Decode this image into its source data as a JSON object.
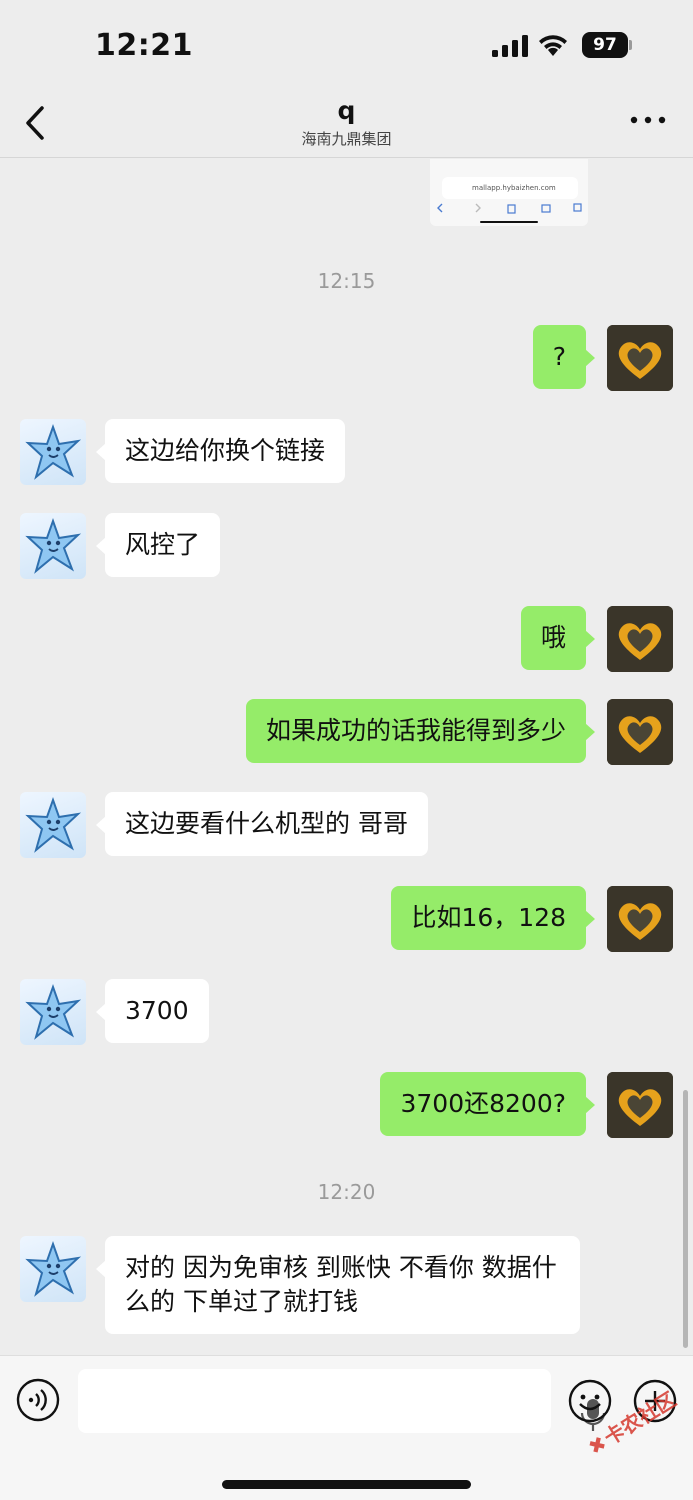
{
  "status_bar": {
    "time": "12:21",
    "battery": "97"
  },
  "nav": {
    "title": "q",
    "subtitle": "海南九鼎集团"
  },
  "screenshot_thumb": {
    "url": "mallapp.hybaizhen.com"
  },
  "timestamps": [
    "12:15",
    "12:20"
  ],
  "messages": [
    {
      "from": "self",
      "text": "?"
    },
    {
      "from": "other",
      "text": "这边给你换个链接"
    },
    {
      "from": "other",
      "text": "风控了"
    },
    {
      "from": "self",
      "text": "哦"
    },
    {
      "from": "self",
      "text": "如果成功的话我能得到多少"
    },
    {
      "from": "other",
      "text": "这边要看什么机型的 哥哥"
    },
    {
      "from": "self",
      "text": "比如16，128"
    },
    {
      "from": "other",
      "text": "3700"
    },
    {
      "from": "self",
      "text": "3700还8200?"
    },
    {
      "from": "other",
      "text": "对的 因为免审核 到账快 不看你 数据什么的 下单过了就打钱"
    }
  ],
  "watermark": {
    "text": "卡农社区"
  },
  "colors": {
    "background": "#ededed",
    "self_bubble": "#95ec69",
    "other_bubble": "#ffffff"
  },
  "icons": {
    "back": "chevron-left-icon",
    "more": "more-dots-icon",
    "voice": "voice-icon",
    "mic": "microphone-icon",
    "emoji": "emoji-icon",
    "plus": "plus-icon"
  }
}
